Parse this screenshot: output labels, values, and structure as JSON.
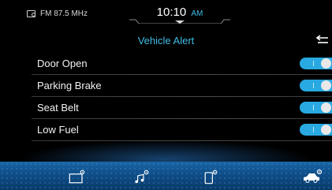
{
  "status": {
    "radio_icon": "radio-icon",
    "radio_text": "FM 87.5 MHz",
    "time": "10:10",
    "ampm": "AM"
  },
  "header": {
    "title": "Vehicle Alert",
    "back_icon": "back-arrow-icon"
  },
  "alerts": [
    {
      "label": "Door Open",
      "enabled": true
    },
    {
      "label": "Parking Brake",
      "enabled": true
    },
    {
      "label": "Seat Belt",
      "enabled": true
    },
    {
      "label": "Low Fuel",
      "enabled": true
    }
  ],
  "nav": [
    {
      "icon": "display-settings-icon"
    },
    {
      "icon": "audio-settings-icon"
    },
    {
      "icon": "phone-settings-icon"
    },
    {
      "icon": "vehicle-settings-icon"
    }
  ],
  "colors": {
    "accent": "#3fbde6",
    "toggle_on": "#29a9e1",
    "nav_bar": "#0f4f8a"
  }
}
